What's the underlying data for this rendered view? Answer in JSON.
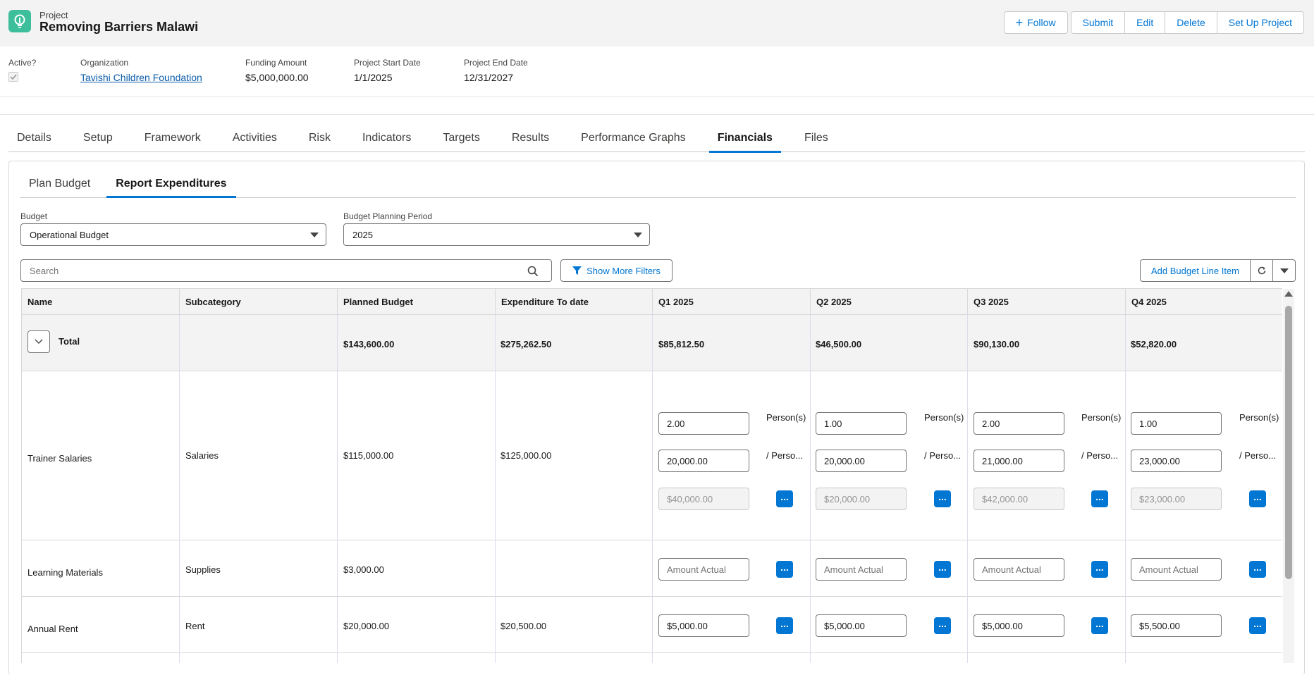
{
  "header": {
    "object_type": "Project",
    "title": "Removing Barriers Malawi",
    "follow_label": "Follow",
    "actions": [
      "Submit",
      "Edit",
      "Delete",
      "Set Up Project"
    ]
  },
  "highlights": {
    "active_label": "Active?",
    "active_checked": true,
    "organization_label": "Organization",
    "organization_value": "Tavishi Children Foundation",
    "funding_label": "Funding Amount",
    "funding_value": "$5,000,000.00",
    "start_label": "Project Start Date",
    "start_value": "1/1/2025",
    "end_label": "Project End Date",
    "end_value": "12/31/2027"
  },
  "main_tabs": [
    "Details",
    "Setup",
    "Framework",
    "Activities",
    "Risk",
    "Indicators",
    "Targets",
    "Results",
    "Performance Graphs",
    "Financials",
    "Files"
  ],
  "main_tabs_active": "Financials",
  "sub_tabs": [
    "Plan Budget",
    "Report Expenditures"
  ],
  "sub_tabs_active": "Report Expenditures",
  "filters": {
    "budget_label": "Budget",
    "budget_value": "Operational Budget",
    "period_label": "Budget Planning Period",
    "period_value": "2025",
    "search_placeholder": "Search",
    "show_more_filters": "Show More Filters",
    "add_line_item": "Add Budget Line Item"
  },
  "grid": {
    "columns": [
      "Name",
      "Subcategory",
      "Planned Budget",
      "Expenditure To date",
      "Q1 2025",
      "Q2 2025",
      "Q3 2025",
      "Q4 2025"
    ],
    "total": {
      "label": "Total",
      "planned": "$143,600.00",
      "expenditure": "$275,262.50",
      "quarters": [
        "$85,812.50",
        "$46,500.00",
        "$90,130.00",
        "$52,820.00"
      ]
    },
    "rows": [
      {
        "name": "Trainer Salaries",
        "subcategory": "Salaries",
        "planned": "$115,000.00",
        "expenditure": "$125,000.00",
        "unit_label": "Person(s)",
        "rate_label": "/ Perso...",
        "quarters": [
          {
            "qty": "2.00",
            "rate": "20,000.00",
            "total": "$40,000.00"
          },
          {
            "qty": "1.00",
            "rate": "20,000.00",
            "total": "$20,000.00"
          },
          {
            "qty": "2.00",
            "rate": "21,000.00",
            "total": "$42,000.00"
          },
          {
            "qty": "1.00",
            "rate": "23,000.00",
            "total": "$23,000.00"
          }
        ]
      },
      {
        "name": "Learning Materials",
        "subcategory": "Supplies",
        "planned": "$3,000.00",
        "expenditure": "",
        "placeholder": "Amount Actual",
        "quarters": [
          "",
          "",
          "",
          ""
        ]
      },
      {
        "name": "Annual Rent",
        "subcategory": "Rent",
        "planned": "$20,000.00",
        "expenditure": "$20,500.00",
        "quarters": [
          "$5,000.00",
          "$5,000.00",
          "$5,000.00",
          "$5,500.00"
        ]
      }
    ]
  },
  "colors": {
    "brand_blue": "#0176d3",
    "app_icon": "#3ebf9c",
    "header_bg": "#f3f3f3"
  }
}
